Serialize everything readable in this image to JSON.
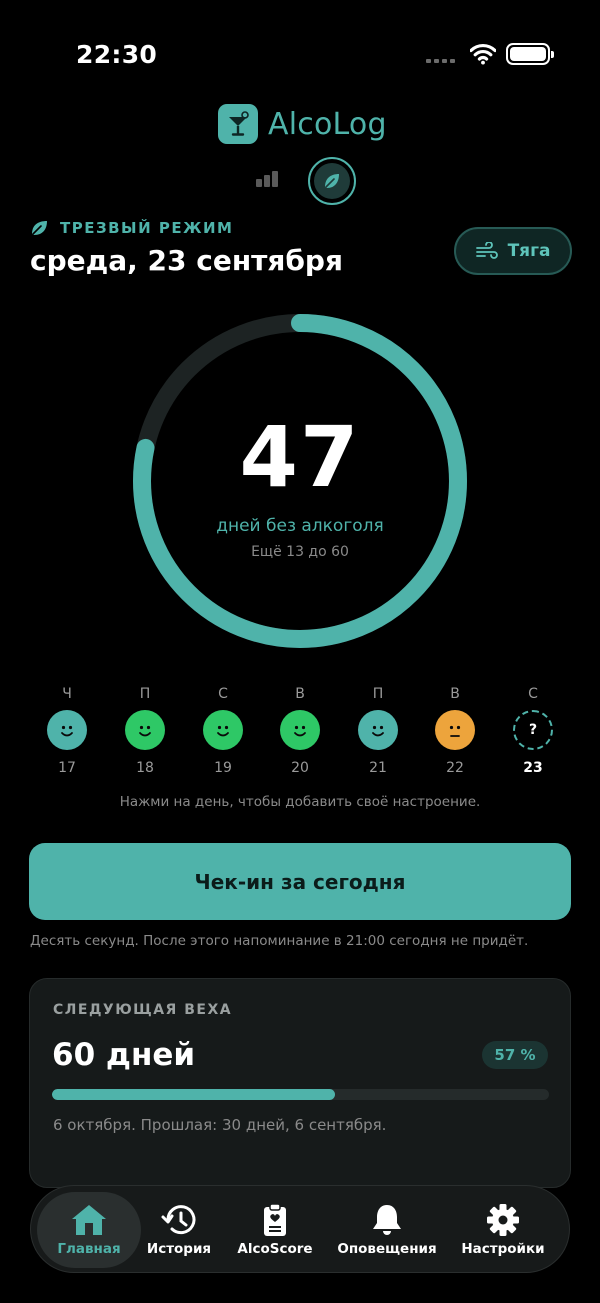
{
  "status_bar": {
    "time": "22:30",
    "wifi_icon": "wifi-icon",
    "battery_icon": "battery-icon"
  },
  "app": {
    "name": "AlcoLog",
    "logo_icon": "cocktail-glass-icon"
  },
  "mode_switch": {
    "stats_icon": "bar-chart-icon",
    "sober_icon": "leaf-icon",
    "active": "sober"
  },
  "header": {
    "mode_label": "ТРЕЗВЫЙ РЕЖИМ",
    "date": "среда, 23 сентября",
    "craving_button": "Тяга",
    "craving_icon": "wind-icon"
  },
  "counter": {
    "days": "47",
    "caption": "дней без алкоголя",
    "subcaption": "Ещё 13 до 60",
    "progress_fraction": 0.7833
  },
  "week": {
    "days": [
      {
        "letter": "Ч",
        "date": "17",
        "mood": "calm"
      },
      {
        "letter": "П",
        "date": "18",
        "mood": "happy"
      },
      {
        "letter": "С",
        "date": "19",
        "mood": "happy"
      },
      {
        "letter": "В",
        "date": "20",
        "mood": "happy"
      },
      {
        "letter": "П",
        "date": "21",
        "mood": "calm"
      },
      {
        "letter": "В",
        "date": "22",
        "mood": "neutral"
      },
      {
        "letter": "С",
        "date": "23",
        "mood": "unknown",
        "empty_symbol": "?"
      }
    ],
    "hint": "Нажми на день, чтобы добавить своё настроение."
  },
  "checkin": {
    "label": "Чек-ин за сегодня",
    "hint": "Десять секунд. После этого напоминание в 21:00 сегодня не придёт."
  },
  "milestone": {
    "label": "СЛЕДУЮЩАЯ ВЕХА",
    "title": "60 дней",
    "percent_label": "57 %",
    "progress_fraction": 0.57,
    "note": "6 октября. Прошлая: 30 дней, 6 сентября."
  },
  "tabs": [
    {
      "label": "Главная",
      "icon": "home-icon",
      "active": true
    },
    {
      "label": "История",
      "icon": "history-icon",
      "active": false
    },
    {
      "label": "AlcoScore",
      "icon": "clipboard-heart-icon",
      "active": false
    },
    {
      "label": "Оповещения",
      "icon": "bell-icon",
      "active": false
    },
    {
      "label": "Настройки",
      "icon": "gear-icon",
      "active": false
    }
  ],
  "colors": {
    "accent": "#4fb3aa",
    "mood_calm": "#4fb3aa",
    "mood_happy": "#2ec866",
    "mood_neutral": "#eda43c",
    "background": "#000000"
  }
}
